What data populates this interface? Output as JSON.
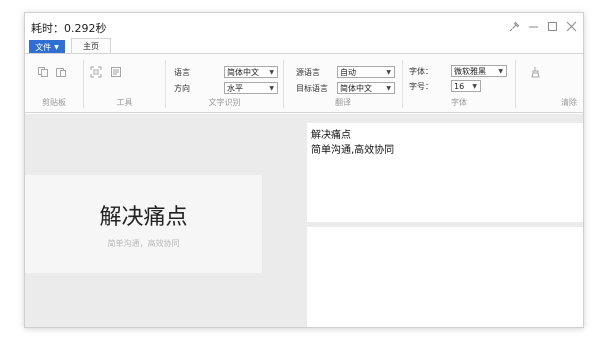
{
  "window": {
    "title": "耗时：0.292秒"
  },
  "tabs": {
    "file": "文件",
    "home": "主页"
  },
  "ribbon": {
    "clipboard": {
      "label": "剪贴板"
    },
    "tools": {
      "label": "工具"
    },
    "ocr": {
      "label": "文字识别",
      "language_label": "语言",
      "language_value": "简体中文",
      "direction_label": "方向",
      "direction_value": "水平"
    },
    "translate": {
      "label": "翻译",
      "source_label": "源语言",
      "source_value": "自动",
      "target_label": "目标语言",
      "target_value": "简体中文"
    },
    "font": {
      "label": "字体",
      "font_label": "字体：",
      "font_value": "微软雅黑",
      "size_label": "字号：",
      "size_value": "16"
    },
    "clear": {
      "label": "清除"
    }
  },
  "image_card": {
    "title": "解决痛点",
    "subtitle": "简单沟通，高效协同"
  },
  "result": {
    "lines": [
      "解决痛点",
      "简单沟通,高效协同"
    ]
  },
  "colors": {
    "accent": "#2f6fd3",
    "content_bg": "#ebebeb"
  }
}
